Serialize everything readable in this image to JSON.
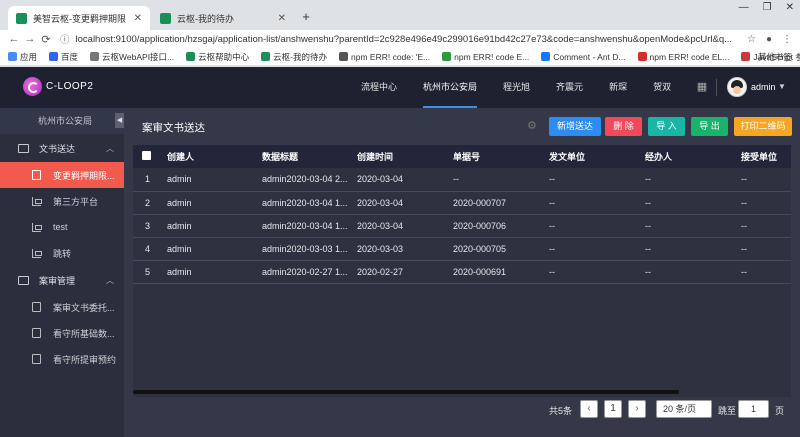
{
  "browser": {
    "tabs": [
      {
        "title": "美智云枢-变更羁押期限通知书",
        "active": true
      },
      {
        "title": "云枢-我的待办",
        "active": false
      }
    ],
    "url": "localhost:9100/application/hzsgaj/application-list/anshwenshu?parentId=2c928e496e49c299016e91bd42c27e73&code=anshwenshu&openMode&pcUrl&q...",
    "bookmarks": [
      {
        "label": "应用",
        "color": "#4a8af4"
      },
      {
        "label": "百度",
        "color": "#2f65e8"
      },
      {
        "label": "云枢WebAPI接口...",
        "color": "#777"
      },
      {
        "label": "云枢帮助中心",
        "color": "#1b8f5a"
      },
      {
        "label": "云枢-我的待办",
        "color": "#1b8f5a"
      },
      {
        "label": "npm ERR! code: 'E...",
        "color": "#555"
      },
      {
        "label": "npm ERR! code E...",
        "color": "#2e9a3e"
      },
      {
        "label": "Comment - Ant D...",
        "color": "#1677ff"
      },
      {
        "label": "npm ERR! code EL...",
        "color": "#d0302c"
      },
      {
        "label": "JavaScript 参考手册",
        "color": "#c83a3a"
      }
    ],
    "bookmarks_more": "其他书签"
  },
  "header": {
    "logo_text": "C-LOOP2",
    "nav": [
      {
        "label": "流程中心",
        "active": false
      },
      {
        "label": "杭州市公安局",
        "active": true
      },
      {
        "label": "程光旭",
        "active": false
      },
      {
        "label": "齐震元",
        "active": false
      },
      {
        "label": "新琛",
        "active": false
      },
      {
        "label": "贺双",
        "active": false
      }
    ],
    "username": "admin"
  },
  "sidebar": {
    "org": "杭州市公安局",
    "groups": [
      {
        "label": "文书送达",
        "items": [
          {
            "label": "变更羁押期限...",
            "active": true,
            "icon": "document-icon"
          },
          {
            "label": "第三方平台",
            "active": false,
            "icon": "tree-icon"
          },
          {
            "label": "test",
            "active": false,
            "icon": "tree-icon"
          },
          {
            "label": "跳转",
            "active": false,
            "icon": "tree-icon"
          }
        ]
      },
      {
        "label": "案审管理",
        "items": [
          {
            "label": "案审文书委托...",
            "active": false,
            "icon": "document-icon"
          },
          {
            "label": "看守所基础数...",
            "active": false,
            "icon": "document-icon"
          },
          {
            "label": "看守所提审预约",
            "active": false,
            "icon": "document-icon"
          }
        ]
      }
    ]
  },
  "main": {
    "title": "案审文书送达",
    "buttons": {
      "add": "新增送达",
      "delete": "删 除",
      "import": "导 入",
      "export": "导 出",
      "qr": "打印二维码"
    },
    "table": {
      "columns": [
        "创建人",
        "数据标题",
        "创建时间",
        "单据号",
        "发文单位",
        "经办人",
        "接受单位"
      ],
      "rows": [
        [
          "1",
          "admin",
          "admin2020-03-04 2...",
          "2020-03-04",
          "--",
          "--",
          "--",
          "--"
        ],
        [
          "2",
          "admin",
          "admin2020-03-04 1...",
          "2020-03-04",
          "2020-000707",
          "--",
          "--",
          "--"
        ],
        [
          "3",
          "admin",
          "admin2020-03-04 1...",
          "2020-03-04",
          "2020-000706",
          "--",
          "--",
          "--"
        ],
        [
          "4",
          "admin",
          "admin2020-03-03 1...",
          "2020-03-03",
          "2020-000705",
          "--",
          "--",
          "--"
        ],
        [
          "5",
          "admin",
          "admin2020-02-27 1...",
          "2020-02-27",
          "2020-000691",
          "--",
          "--",
          "--"
        ]
      ]
    },
    "pager": {
      "total": "共5条",
      "current_page": "1",
      "page_size": "20 条/页",
      "goto_label": "跳至",
      "goto_value": "1",
      "page_suffix": "页"
    }
  }
}
